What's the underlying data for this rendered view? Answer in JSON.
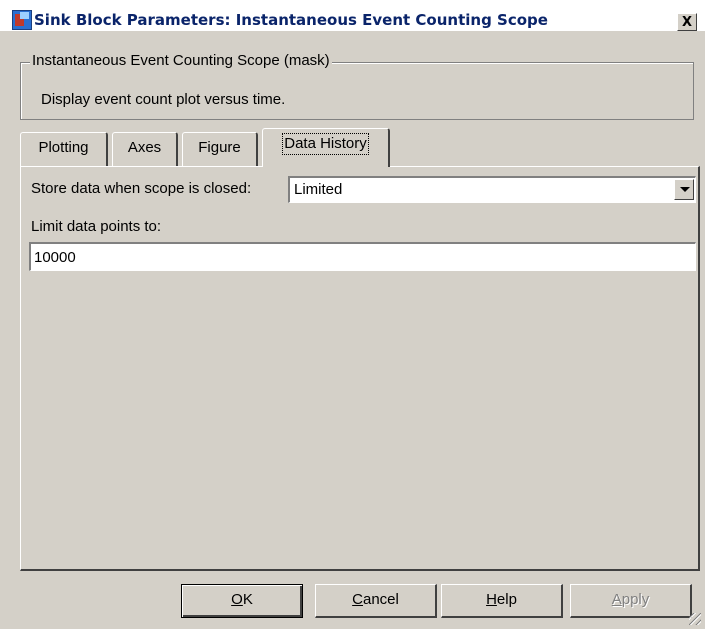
{
  "window": {
    "title": "Sink Block Parameters: Instantaneous Event Counting Scope",
    "close_label": "X"
  },
  "block": {
    "group_title": "Instantaneous Event Counting Scope (mask)",
    "description": "Display event count plot versus time."
  },
  "tabs": [
    {
      "label": "Plotting",
      "active": false
    },
    {
      "label": "Axes",
      "active": false
    },
    {
      "label": "Figure",
      "active": false
    },
    {
      "label": "Data History",
      "active": true
    }
  ],
  "data_history": {
    "store_label": "Store data when scope is closed:",
    "store_value": "Limited",
    "limit_label": "Limit data points to:",
    "limit_value": "10000"
  },
  "buttons": {
    "ok": {
      "mnemonic": "O",
      "rest": "K"
    },
    "cancel": {
      "mnemonic": "C",
      "rest": "ancel"
    },
    "help": {
      "mnemonic": "H",
      "rest": "elp"
    },
    "apply": {
      "mnemonic": "A",
      "rest": "pply",
      "enabled": false
    }
  }
}
